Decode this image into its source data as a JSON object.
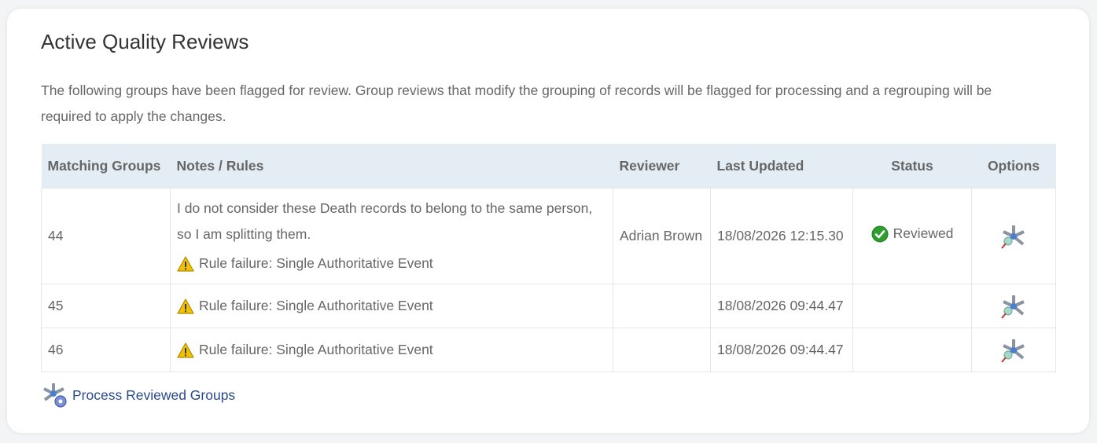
{
  "section": {
    "title": "Active Quality Reviews",
    "intro": "The following groups have been flagged for review. Group reviews that modify the grouping of records will be flagged for processing and a regrouping will be required to apply the changes."
  },
  "table": {
    "headers": {
      "matching_groups": "Matching Groups",
      "notes_rules": "Notes / Rules",
      "reviewer": "Reviewer",
      "last_updated": "Last Updated",
      "status": "Status",
      "options": "Options"
    },
    "rows": [
      {
        "group": "44",
        "note": "I do not consider these Death records to belong to the same person, so I am splitting them.",
        "rule": "Rule failure: Single Authoritative Event",
        "reviewer": "Adrian Brown",
        "last_updated": "18/08/2026 12:15.30",
        "status": "Reviewed"
      },
      {
        "group": "45",
        "note": "",
        "rule": "Rule failure: Single Authoritative Event",
        "reviewer": "",
        "last_updated": "18/08/2026 09:44.47",
        "status": ""
      },
      {
        "group": "46",
        "note": "",
        "rule": "Rule failure: Single Authoritative Event",
        "reviewer": "",
        "last_updated": "18/08/2026 09:44.47",
        "status": ""
      }
    ]
  },
  "actions": {
    "process_label": "Process Reviewed Groups"
  },
  "icons": {
    "warning": "warning-icon",
    "reviewed": "checkmark-icon",
    "options": "molecule-tool-icon",
    "process": "molecule-gear-icon"
  },
  "colors": {
    "header_bg": "#e4ecf4",
    "link": "#2b4a8c",
    "ok_green": "#2e9e2e",
    "warning_yellow": "#f2c200"
  }
}
